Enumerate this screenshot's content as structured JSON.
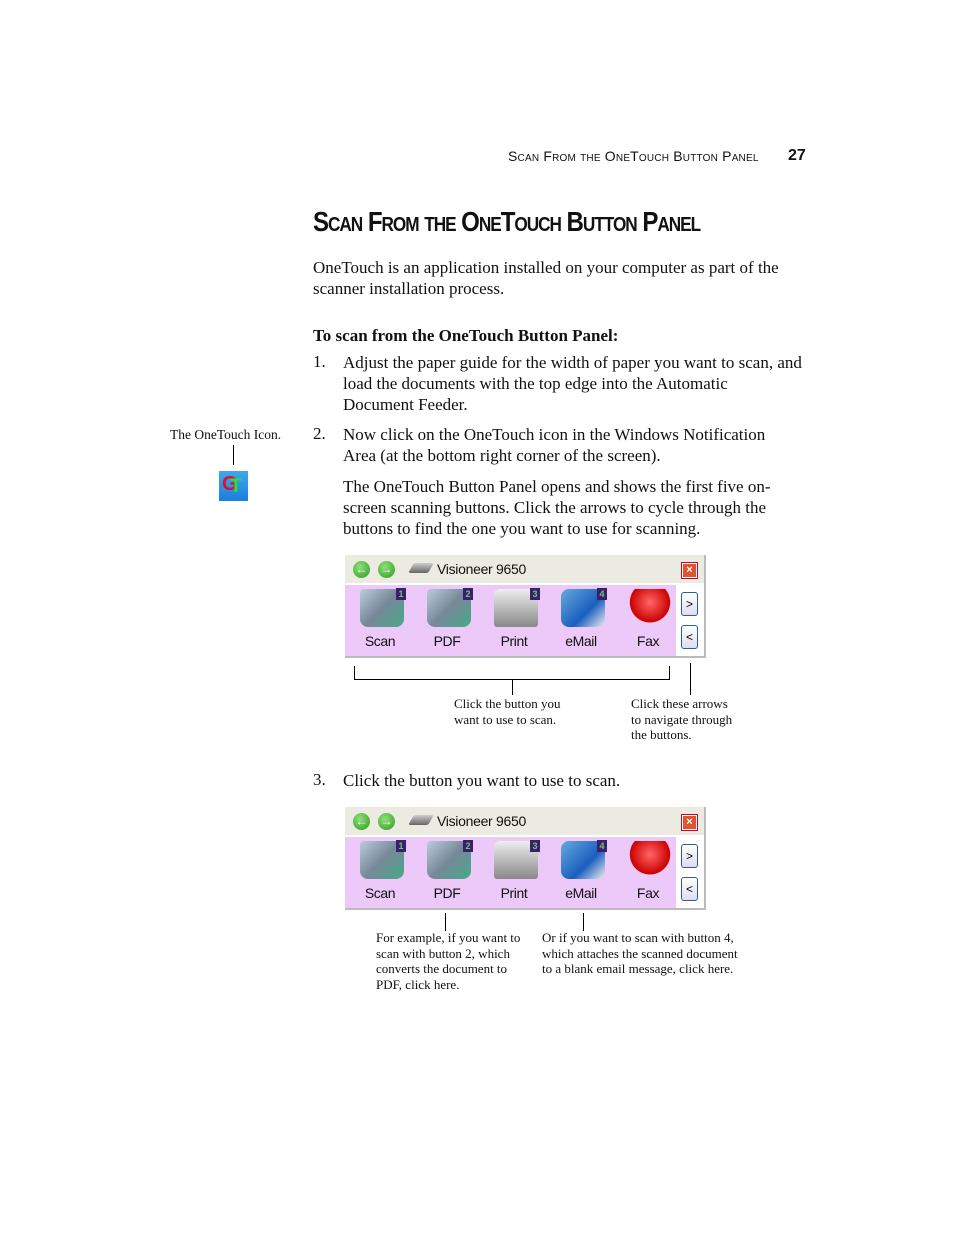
{
  "header": {
    "running_head": "Scan From the OneTouch Button Panel",
    "page_number": "27"
  },
  "title": "Scan From the OneTouch Button Panel",
  "intro": [
    "OneTouch is an application installed on your computer as part of the",
    "scanner installation process."
  ],
  "procedure_heading": "To scan from the OneTouch Button Panel:",
  "steps": [
    {
      "num": "1.",
      "lines": [
        "Adjust the paper guide for the width of paper you want to scan, and",
        "load the documents with the top edge into the Automatic",
        "Document Feeder."
      ]
    },
    {
      "num": "2.",
      "lines": [
        "Now click on the OneTouch icon in the Windows Notification",
        "Area (at the bottom right corner of the screen)."
      ],
      "extra": [
        "The OneTouch Button Panel opens and shows the first five on-",
        "screen scanning buttons. Click the arrows to cycle through the",
        "buttons to find the one you want to use for scanning."
      ]
    },
    {
      "num": "3.",
      "lines": [
        "Click the button you want to use to scan."
      ]
    }
  ],
  "margin_note": "The OneTouch Icon.",
  "onetouch_icon_letters": "OT",
  "panel": {
    "title": "Visioneer 9650",
    "buttons": [
      {
        "label": "Scan",
        "badge": "1",
        "icon": "scan-icon"
      },
      {
        "label": "PDF",
        "badge": "2",
        "icon": "pdf-scan-icon"
      },
      {
        "label": "Print",
        "badge": "3",
        "icon": "printer-icon"
      },
      {
        "label": "eMail",
        "badge": "4",
        "icon": "email-icon"
      },
      {
        "label": "Fax",
        "badge": "",
        "icon": "question-mark-icon"
      }
    ],
    "next": ">",
    "prev": "<",
    "back_glyph": "←",
    "fwd_glyph": "→",
    "close_glyph": "×",
    "colors": {
      "button_area": "#ecc9f8",
      "title_bar": "#ecebe2",
      "close": "#e0542e"
    }
  },
  "captions1": {
    "buttons": [
      "Click the button you",
      "want to use to scan."
    ],
    "arrows": [
      "Click these arrows",
      "to navigate through",
      "the buttons."
    ]
  },
  "captions2": {
    "pdf": [
      "For example, if you want to",
      "scan with button 2, which",
      "converts the document to",
      "PDF, click here."
    ],
    "email": [
      "Or if you want to scan with button 4,",
      "which attaches the scanned document",
      "to a blank email message, click here."
    ]
  }
}
